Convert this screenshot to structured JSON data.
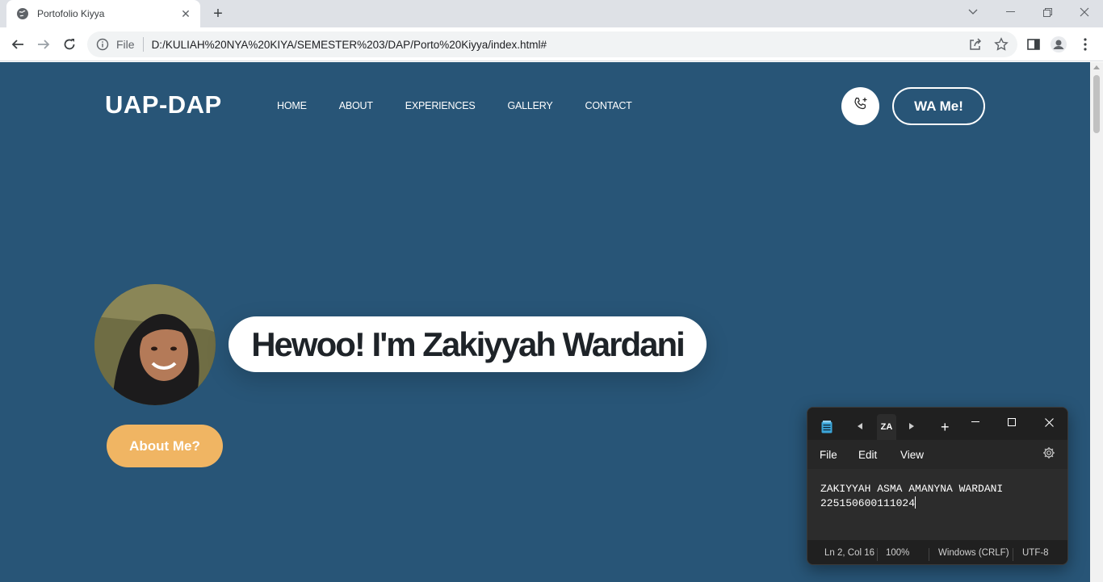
{
  "browser": {
    "tab_title": "Portofolio Kiyya",
    "url_scheme": "File",
    "url": "D:/KULIAH%20NYA%20KIYA/SEMESTER%203/DAP/Porto%20Kiyya/index.html#"
  },
  "site": {
    "brand": "UAP-DAP",
    "nav": [
      "HOME",
      "ABOUT",
      "EXPERIENCES",
      "GALLERY",
      "CONTACT"
    ],
    "wa_button": "WA Me!",
    "greeting": "Hewoo! I'm Zakiyyah Wardani",
    "about_button": "About Me?",
    "colors": {
      "background": "#285577",
      "accent": "#f0b563"
    }
  },
  "notepad": {
    "tab_label": "ZA",
    "menu": [
      "File",
      "Edit",
      "View"
    ],
    "lines": [
      "ZAKIYYAH ASMA AMANYNA WARDANI",
      "225150600111024"
    ],
    "status": {
      "position": "Ln 2, Col 16",
      "zoom": "100%",
      "line_ending": "Windows (CRLF)",
      "encoding": "UTF-8"
    }
  }
}
